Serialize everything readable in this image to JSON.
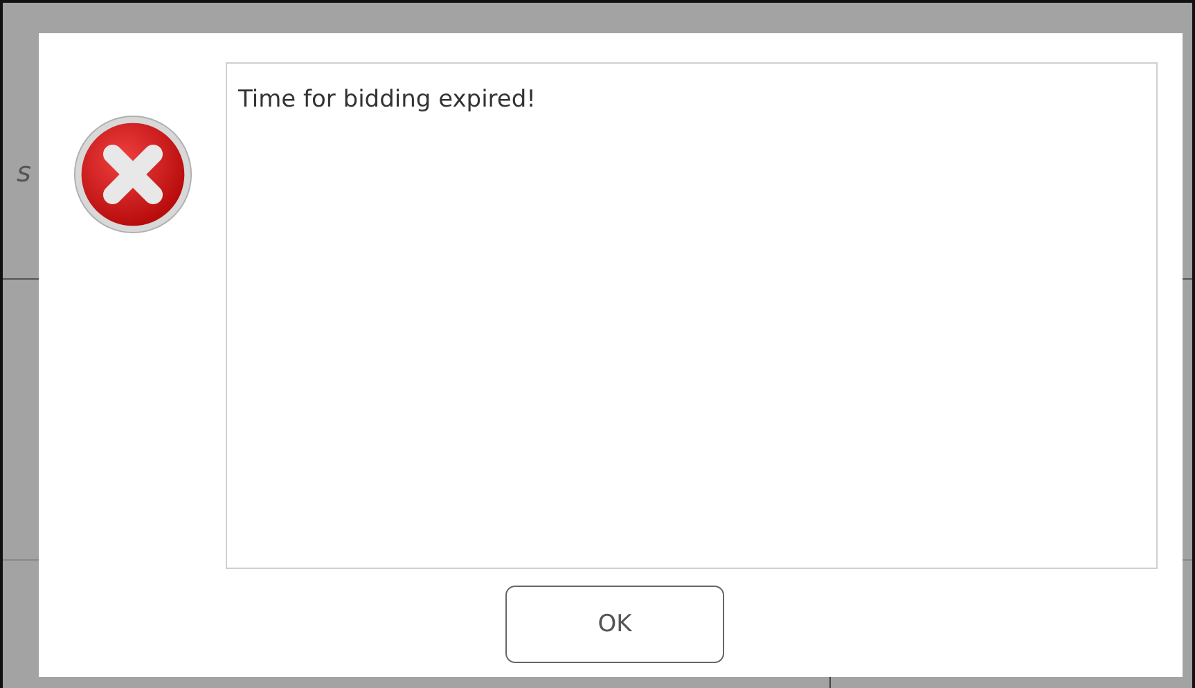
{
  "background": {
    "fragment": "s"
  },
  "dialog": {
    "kind": "error",
    "message": "Time for bidding expired!",
    "buttons": [
      "OK"
    ]
  }
}
